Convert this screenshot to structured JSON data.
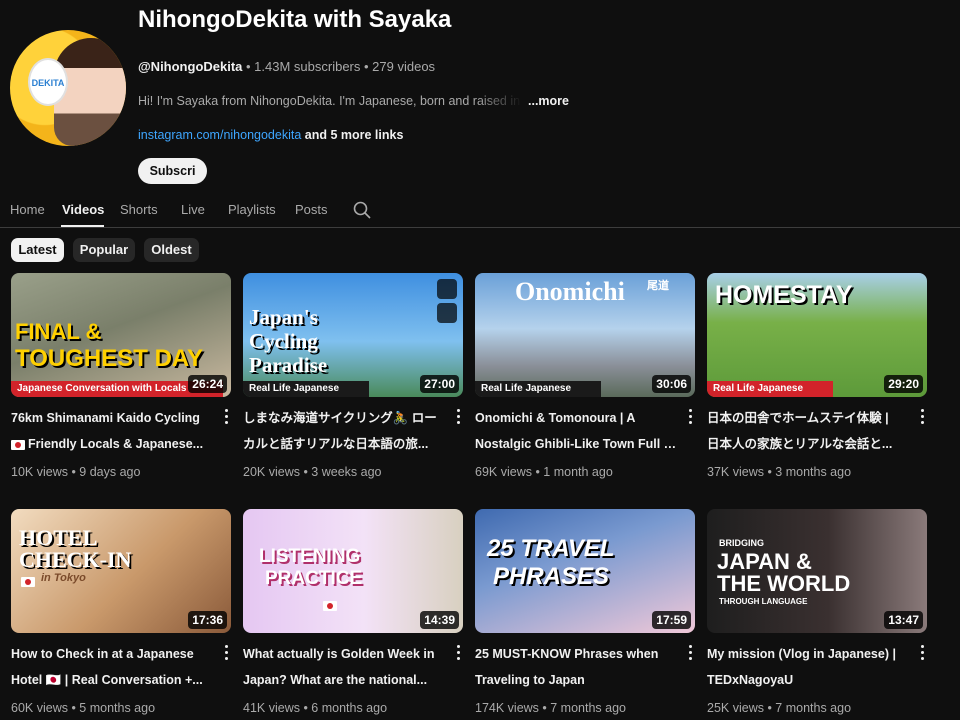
{
  "channel": {
    "title": "NihongoDekita with Sayaka",
    "handle": "@NihongoDekita",
    "stats": " • 1.43M subscribers • 279 videos",
    "description": "Hi! I'm Sayaka from NihongoDekita. I'm Japanese, born and raised in",
    "more_label": "...more",
    "link": "instagram.com/nihongodekita",
    "more_links": " and 5 more links",
    "subscribe_label": "Subscri",
    "avatar_sign": "DEKITA"
  },
  "tabs": [
    "Home",
    "Videos",
    "Shorts",
    "Live",
    "Playlists",
    "Posts"
  ],
  "active_tab": "Videos",
  "chips": [
    "Latest",
    "Popular",
    "Oldest"
  ],
  "active_chip": "Latest",
  "videos": [
    {
      "thumb_lines": [
        "FINAL &",
        "TOUGHEST DAY"
      ],
      "banner": "Japanese Conversation with Locals",
      "duration": "26:24",
      "title_line1": "76km Shimanami Kaido Cycling",
      "title_line2": "Friendly Locals & Japanese...",
      "meta": "10K views • 9 days ago",
      "colors": [
        "#8a8f7a",
        "#c6b89a"
      ]
    },
    {
      "thumb_lines": [
        "Japan's",
        "Cycling",
        "Paradise"
      ],
      "banner": "Real Life Japanese",
      "duration": "27:00",
      "title_line1": "しまなみ海道サイクリング🚴 ロー",
      "title_line2": "カルと話すリアルな日本語の旅...",
      "meta": "20K views • 3 weeks ago",
      "colors": [
        "#4f9ee3",
        "#8cc6f0"
      ]
    },
    {
      "thumb_lines": [
        "Onomichi"
      ],
      "sub_text": "尾道",
      "banner": "Real Life Japanese",
      "duration": "30:06",
      "title_line1": "Onomichi & Tomonoura | A",
      "title_line2": "Nostalgic Ghibli-Like Town Full o...",
      "meta": "69K views • 1 month ago",
      "colors": [
        "#6fa2d8",
        "#b8d4ec"
      ]
    },
    {
      "thumb_lines": [
        "HOMESTAY"
      ],
      "banner": "Real Life Japanese",
      "duration": "29:20",
      "title_line1": "日本の田舎でホームステイ体験 |",
      "title_line2": "日本人の家族とリアルな会話と...",
      "meta": "37K views • 3 months ago",
      "colors": [
        "#5f9a3a",
        "#9fcf6a"
      ]
    },
    {
      "thumb_lines": [
        "HOTEL",
        "CHECK-IN"
      ],
      "sub_text": "in Tokyo",
      "duration": "17:36",
      "title_line1": "How to Check in at a Japanese",
      "title_line2": "Hotel 🇯🇵 | Real Conversation +...",
      "meta": "60K views • 5 months ago",
      "colors": [
        "#c89a6a",
        "#efd4b0"
      ]
    },
    {
      "thumb_lines": [
        "LISTENING",
        "PRACTICE"
      ],
      "duration": "14:39",
      "title_line1": "What actually is Golden Week in",
      "title_line2": "Japan? What are the national...",
      "meta": "41K views • 6 months ago",
      "colors": [
        "#d9b4ec",
        "#f3e0f8"
      ]
    },
    {
      "thumb_lines": [
        "25 TRAVEL",
        "PHRASES"
      ],
      "duration": "17:59",
      "title_line1": "25 MUST-KNOW Phrases when",
      "title_line2": "Traveling to Japan",
      "meta": "174K views • 7 months ago",
      "colors": [
        "#4a6fa8",
        "#e9b9c9"
      ]
    },
    {
      "thumb_lines": [
        "JAPAN &",
        "THE WORLD"
      ],
      "top_text": "BRIDGING",
      "sub_text": "THROUGH LANGUAGE",
      "duration": "13:47",
      "title_line1": "My mission (Vlog in Japanese) |",
      "title_line2": "TEDxNagoyaU",
      "meta": "25K views • 7 months ago",
      "colors": [
        "#2a2a2a",
        "#6a5a5a"
      ]
    }
  ]
}
